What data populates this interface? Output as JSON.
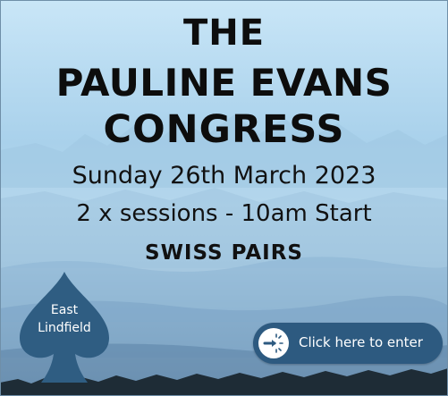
{
  "title": {
    "line1": "THE",
    "line2": "PAULINE EVANS",
    "line3": "CONGRESS"
  },
  "event": {
    "date": "Sunday 26th March 2023",
    "sessions": "2 x sessions - 10am Start",
    "format": "SWISS PAIRS"
  },
  "club": {
    "logo_icon": "spade-icon",
    "line1": "East",
    "line2": "Lindfield"
  },
  "cta": {
    "label": "Click here to enter",
    "icon": "click-cursor-icon"
  },
  "colors": {
    "title_text": "#0d0d0d",
    "spade": "#2f5d82",
    "button": "#2d5a80",
    "button_text": "#ffffff"
  }
}
